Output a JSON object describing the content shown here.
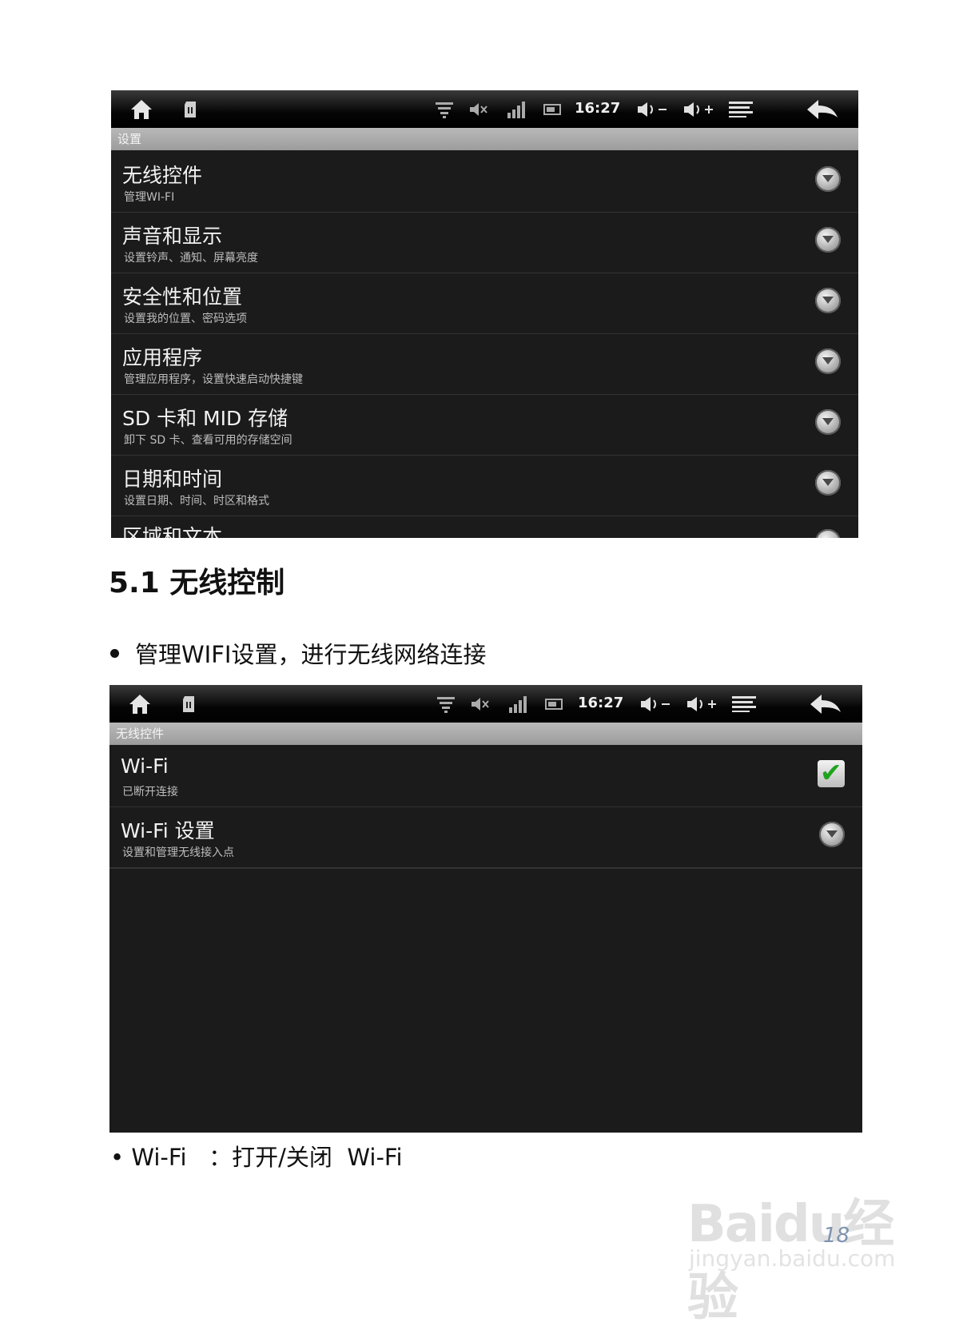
{
  "screenshot1": {
    "status": {
      "time": "16:27"
    },
    "title": "设置",
    "rows": [
      {
        "title": "无线控件",
        "subtitle": "管理WI-FI"
      },
      {
        "title": "声音和显示",
        "subtitle": "设置铃声、通知、屏幕亮度"
      },
      {
        "title": "安全性和位置",
        "subtitle": "设置我的位置、密码选项"
      },
      {
        "title": "应用程序",
        "subtitle": "管理应用程序，设置快速启动快捷键"
      },
      {
        "title": "SD 卡和 MID 存储",
        "subtitle": "卸下 SD 卡、查看可用的存储空间"
      },
      {
        "title": "日期和时间",
        "subtitle": "设置日期、时间、时区和格式"
      },
      {
        "title": "区域和文本",
        "subtitle": ""
      }
    ]
  },
  "heading": "5.1  无线控制",
  "bullet1": "管理WIFI设置，进行无线网络连接",
  "screenshot2": {
    "status": {
      "time": "16:27"
    },
    "title": "无线控件",
    "rows": [
      {
        "title": "Wi-Fi",
        "subtitle": "已断开连接"
      },
      {
        "title": "Wi-Fi 设置",
        "subtitle": "设置和管理无线接入点"
      }
    ]
  },
  "bullet2": "• Wi-Fi   ：打开/关闭  Wi-Fi",
  "watermark": {
    "logo": "Baidu经验",
    "url": "jingyan.baidu.com"
  },
  "page_number": "18",
  "icons": [
    "home-icon",
    "sd-card-icon",
    "wifi-icon",
    "mute-icon",
    "signal-icon",
    "battery-icon",
    "volume-down-icon",
    "volume-up-icon",
    "menu-icon",
    "back-icon",
    "chevron-down-icon",
    "checkbox-checked-icon"
  ]
}
